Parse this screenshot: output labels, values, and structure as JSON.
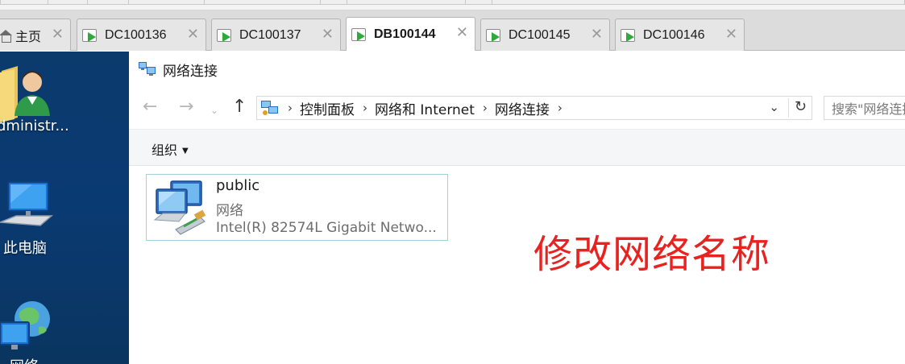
{
  "tabs": [
    {
      "label": "主页",
      "active": false,
      "icon": "home-icon"
    },
    {
      "label": "DC100136",
      "active": false,
      "icon": "vm-console-icon"
    },
    {
      "label": "DC100137",
      "active": false,
      "icon": "vm-console-icon"
    },
    {
      "label": "DB100144",
      "active": true,
      "icon": "vm-console-icon"
    },
    {
      "label": "DC100145",
      "active": false,
      "icon": "vm-console-icon"
    },
    {
      "label": "DC100146",
      "active": false,
      "icon": "vm-console-icon"
    }
  ],
  "tab_close_glyph": "✕",
  "desktop": {
    "items": [
      {
        "label": "dministr...",
        "icon": "user-folder-icon"
      },
      {
        "label": "此电脑",
        "icon": "computer-icon"
      },
      {
        "label": "网络",
        "icon": "network-icon"
      }
    ]
  },
  "explorer": {
    "title": "网络连接",
    "breadcrumbs": [
      "控制面板",
      "网络和 Internet",
      "网络连接"
    ],
    "search_placeholder": "搜索\"网络连接\"",
    "organize_label": "组织",
    "connection": {
      "name": "public",
      "type": "网络",
      "adapter": "Intel(R) 82574L Gigabit Netwo..."
    }
  },
  "annotation": "修改网络名称",
  "colors": {
    "accent_annotation": "#e8231f",
    "desktop_bg": "#0b3a6d",
    "selection_border": "#9fd2de",
    "tab_play_green": "#2eaa3a"
  }
}
